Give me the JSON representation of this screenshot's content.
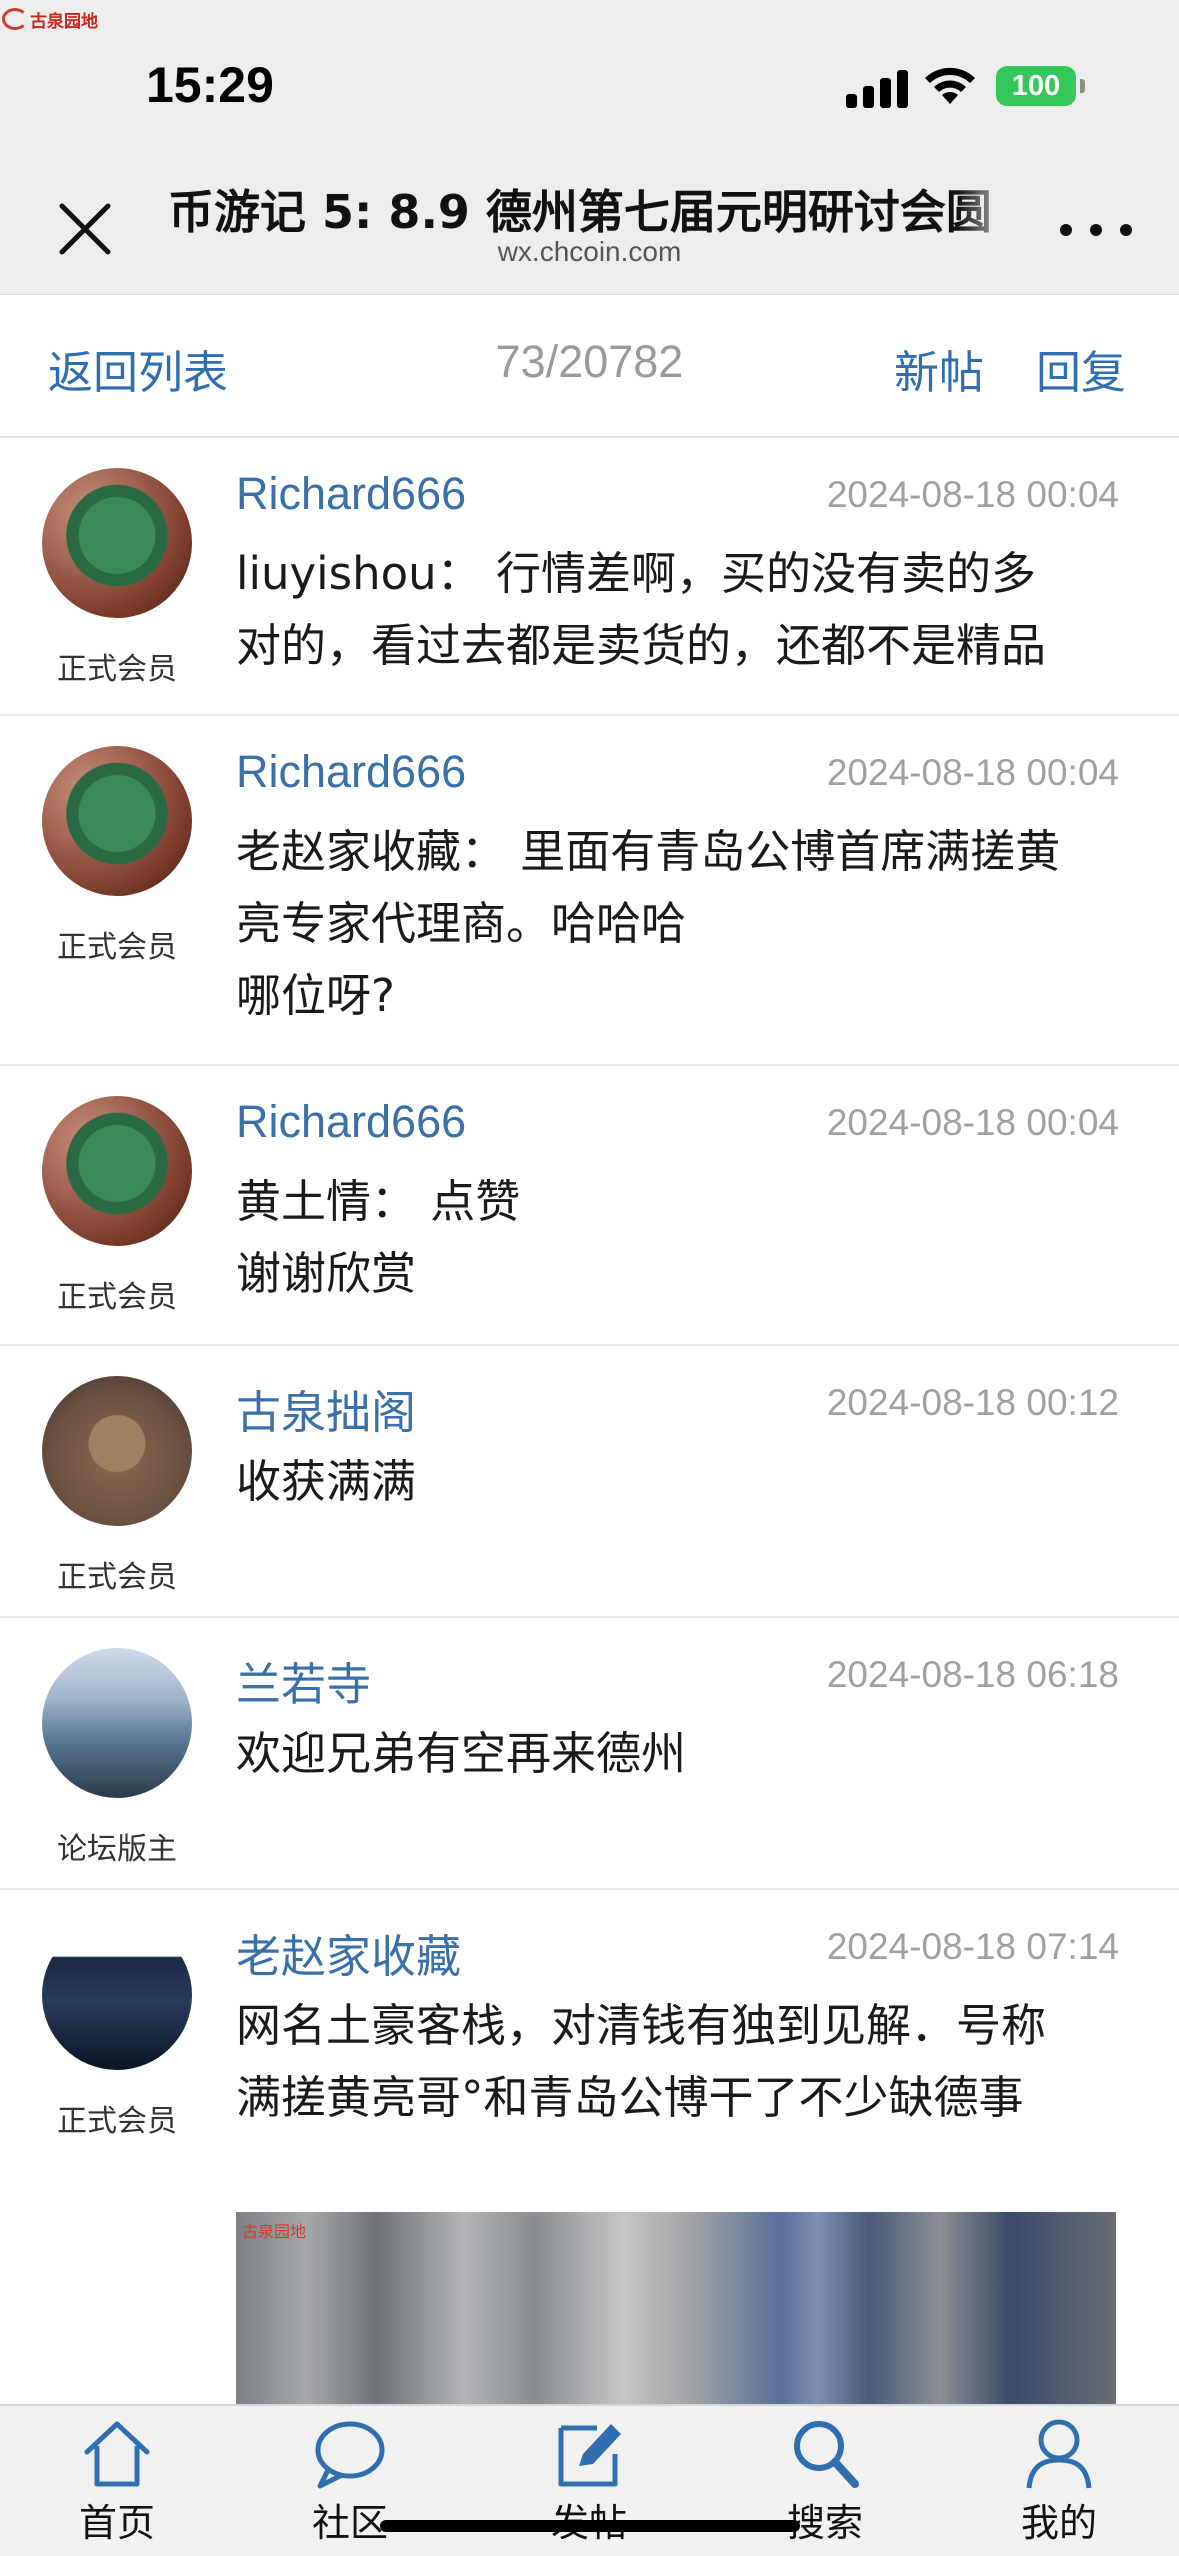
{
  "site_logo": {
    "text": "古泉园地"
  },
  "status_bar": {
    "time": "15:29",
    "battery": "100"
  },
  "browser": {
    "title": "币游记 5: 8.9 德州第七届元明研讨会圆",
    "domain": "wx.chcoin.com"
  },
  "forum_nav": {
    "back_label": "返回列表",
    "count": "73/20782",
    "new_post_label": "新帖",
    "reply_label": "回复"
  },
  "posts": [
    {
      "author": "Richard666",
      "role": "正式会员",
      "time": "2024-08-18 00:04",
      "lines": [
        "liuyishou： 行情差啊，买的没有卖的多",
        "对的，看过去都是卖货的，还都不是精品"
      ]
    },
    {
      "author": "Richard666",
      "role": "正式会员",
      "time": "2024-08-18 00:04",
      "lines": [
        "老赵家收藏： 里面有青岛公博首席满搓黄",
        "亮专家代理商。哈哈哈",
        "哪位呀?"
      ]
    },
    {
      "author": "Richard666",
      "role": "正式会员",
      "time": "2024-08-18 00:04",
      "lines": [
        "黄土情： 点赞",
        "谢谢欣赏"
      ]
    },
    {
      "author": "古泉拙阁",
      "role": "正式会员",
      "time": "2024-08-18 00:12",
      "lines": [
        "收获满满"
      ]
    },
    {
      "author": "兰若寺",
      "role": "论坛版主",
      "time": "2024-08-18 06:18",
      "lines": [
        "欢迎兄弟有空再来德州"
      ]
    },
    {
      "author": "老赵家收藏",
      "role": "正式会员",
      "time": "2024-08-18 07:14",
      "lines": [
        "网名土豪客栈，对清钱有独到见解．号称",
        "满搓黄亮哥°和青岛公博干了不少缺德事"
      ]
    }
  ],
  "post_image": {
    "watermark": "古泉园地"
  },
  "tabbar": {
    "items": [
      {
        "label": "首页",
        "icon": "home-icon"
      },
      {
        "label": "社区",
        "icon": "chat-bubble-icon"
      },
      {
        "label": "发帖",
        "icon": "edit-icon"
      },
      {
        "label": "搜索",
        "icon": "search-icon"
      },
      {
        "label": "我的",
        "icon": "user-icon"
      }
    ]
  },
  "colors": {
    "accent": "#2f6fb0",
    "author": "#3a70a8",
    "timestamp": "#a0a0a0",
    "battery": "#34c759"
  }
}
